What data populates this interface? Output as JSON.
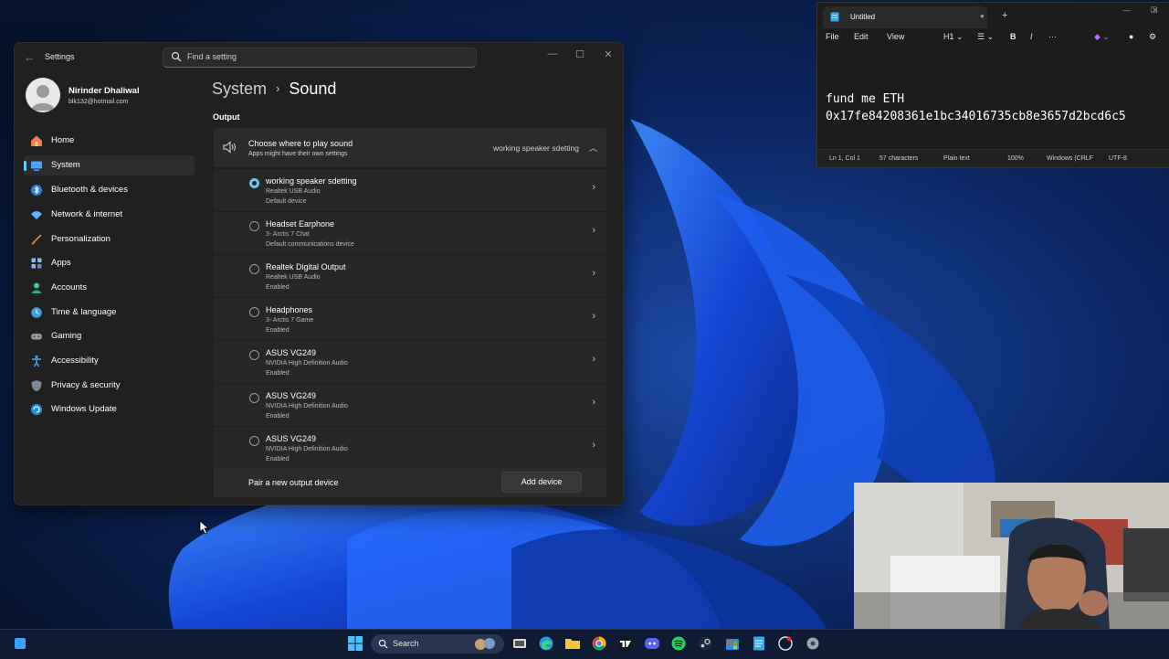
{
  "settings": {
    "app_title": "Settings",
    "search_placeholder": "Find a setting",
    "user": {
      "name": "Nirinder Dhaliwal",
      "email": "blk132@hotmail.com"
    },
    "nav": [
      {
        "label": "Home",
        "icon": "home-icon"
      },
      {
        "label": "System",
        "icon": "system-icon",
        "selected": true
      },
      {
        "label": "Bluetooth & devices",
        "icon": "bluetooth-icon"
      },
      {
        "label": "Network & internet",
        "icon": "network-icon"
      },
      {
        "label": "Personalization",
        "icon": "personalization-icon"
      },
      {
        "label": "Apps",
        "icon": "apps-icon"
      },
      {
        "label": "Accounts",
        "icon": "accounts-icon"
      },
      {
        "label": "Time & language",
        "icon": "time-language-icon"
      },
      {
        "label": "Gaming",
        "icon": "gaming-icon"
      },
      {
        "label": "Accessibility",
        "icon": "accessibility-icon"
      },
      {
        "label": "Privacy & security",
        "icon": "privacy-icon"
      },
      {
        "label": "Windows Update",
        "icon": "windows-update-icon"
      }
    ],
    "breadcrumb": {
      "parent": "System",
      "separator": "›",
      "current": "Sound"
    },
    "output": {
      "section_label": "Output",
      "choose_title": "Choose where to play sound",
      "choose_subtitle": "Apps might have their own settings",
      "current_device": "working speaker sdetting",
      "devices": [
        {
          "name": "working speaker sdetting",
          "driver": "Realtek USB Audio",
          "status": "Default device",
          "selected": true
        },
        {
          "name": "Headset Earphone",
          "driver": "3- Arctis 7 Chat",
          "status": "Default communications device"
        },
        {
          "name": "Realtek Digital Output",
          "driver": "Realtek USB Audio",
          "status": "Enabled"
        },
        {
          "name": "Headphones",
          "driver": "3- Arctis 7 Game",
          "status": "Enabled"
        },
        {
          "name": "ASUS VG249",
          "driver": "NVIDIA High Definition Audio",
          "status": "Enabled"
        },
        {
          "name": "ASUS VG249",
          "driver": "NVIDIA High Definition Audio",
          "status": "Enabled"
        },
        {
          "name": "ASUS VG249",
          "driver": "NVIDIA High Definition Audio",
          "status": "Enabled"
        }
      ],
      "pair_label": "Pair a new output device",
      "add_button": "Add device"
    }
  },
  "notepad": {
    "tab_title": "Untitled",
    "menu": [
      "File",
      "Edit",
      "View"
    ],
    "heading_tool": "H1",
    "text_line1": "fund me ETH",
    "text_line2": "0x17fe84208361e1bc34016735cb8e3657d2bcd6c5",
    "status": {
      "position": "Ln 1, Col 1",
      "characters": "57 characters",
      "format": "Plain text",
      "zoom": "100%",
      "line_ending": "Windows (CRLF",
      "encoding": "UTF-8"
    }
  },
  "taskbar": {
    "search_label": "Search"
  },
  "colors": {
    "accent": "#60cdff",
    "window_bg": "#202020",
    "card_bg": "#2b2b2b"
  }
}
